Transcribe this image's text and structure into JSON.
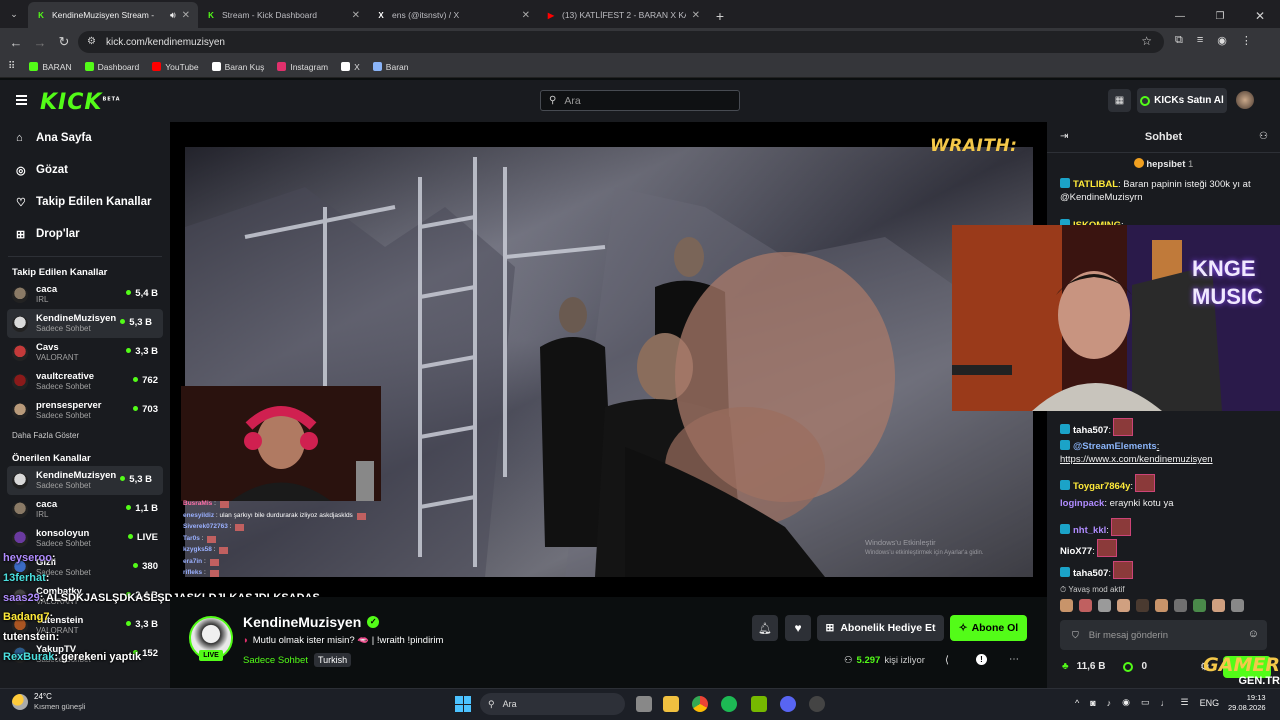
{
  "browser": {
    "tabs": [
      {
        "label": "KendineMuzisyen Stream -",
        "active": true,
        "fav": "K",
        "fav_color": "#53fc18"
      },
      {
        "label": "Stream - Kick Dashboard",
        "active": false,
        "fav": "K",
        "fav_color": "#53fc18"
      },
      {
        "label": "ens (@itsnstv) / X",
        "active": false,
        "fav": "X",
        "fav_color": "#ffffff"
      },
      {
        "label": "(13) KATLİFEST 2 - BARAN X KA",
        "active": false,
        "fav": "▶",
        "fav_color": "#ff0000"
      }
    ],
    "url": "kick.com/kendinemuzisyen",
    "bookmarks": [
      {
        "label": "BARAN",
        "icon": "kick-icon",
        "color": "#53fc18"
      },
      {
        "label": "Dashboard",
        "icon": "kick-icon",
        "color": "#53fc18"
      },
      {
        "label": "YouTube",
        "icon": "youtube-icon",
        "color": "#ff0000"
      },
      {
        "label": "Baran Kuş",
        "icon": "tiktok-icon",
        "color": "#ffffff"
      },
      {
        "label": "Instagram",
        "icon": "instagram-icon",
        "color": "#e1306c"
      },
      {
        "label": "X",
        "icon": "x-icon",
        "color": "#ffffff"
      },
      {
        "label": "Baran",
        "icon": "globe-icon",
        "color": "#8ab4f8"
      }
    ]
  },
  "header": {
    "logo": "KICK",
    "logo_sup": "BETA",
    "search_placeholder": "Ara",
    "buy_kicks": "KICKs Satın Al"
  },
  "sidebar": {
    "nav": [
      {
        "label": "Ana Sayfa",
        "icon": "home-icon"
      },
      {
        "label": "Gözat",
        "icon": "compass-icon"
      },
      {
        "label": "Takip Edilen Kanallar",
        "icon": "heart-icon"
      },
      {
        "label": "Drop'lar",
        "icon": "gift-icon"
      }
    ],
    "followed_title": "Takip Edilen Kanallar",
    "followed": [
      {
        "name": "caca",
        "sub": "IRL",
        "viewers": "5,4 B",
        "color": "#8a7a66"
      },
      {
        "name": "KendineMuzisyen",
        "sub": "Sadece Sohbet",
        "viewers": "5,3 B",
        "color": "#d9d9d9"
      },
      {
        "name": "Cavs",
        "sub": "VALORANT",
        "viewers": "3,3 B",
        "color": "#c43a3a"
      },
      {
        "name": "vaultcreative",
        "sub": "Sadece Sohbet",
        "viewers": "762",
        "color": "#8b1a1a"
      },
      {
        "name": "prensesperver",
        "sub": "Sadece Sohbet",
        "viewers": "703",
        "color": "#b89a7a"
      }
    ],
    "show_more": "Daha Fazla Göster",
    "recommended_title": "Önerilen Kanallar",
    "recommended": [
      {
        "name": "KendineMuzisyen",
        "sub": "Sadece Sohbet",
        "viewers": "5,3 B",
        "color": "#d9d9d9"
      },
      {
        "name": "caca",
        "sub": "IRL",
        "viewers": "1,1 B",
        "color": "#8a7a66"
      },
      {
        "name": "konsoloyun",
        "sub": "Sadece Sohbet",
        "viewers": "LIVE",
        "color": "#6a3aa0"
      },
      {
        "name": "Gizli",
        "sub": "Sadece Sohbet",
        "viewers": "380",
        "color": "#3a6ac4"
      },
      {
        "name": "Combatky",
        "sub": "VALORANT",
        "viewers": "2,4 B",
        "color": "#444"
      },
      {
        "name": "Tutenstein",
        "sub": "VALORANT",
        "viewers": "3,3 B",
        "color": "#aa5522"
      },
      {
        "name": "YakupTV",
        "sub": "Sadece Sohbet",
        "viewers": "152",
        "color": "#2a5a8a"
      }
    ]
  },
  "player": {
    "overlay_brand": "WRAITH:",
    "windows_activate_title": "Windows'u Etkinleştir",
    "windows_activate_sub": "Windows'u etkinleştirmek için Ayarlar'a gidin.",
    "mini_chat": [
      {
        "user": "BusraMis",
        "msg": ":",
        "color": "#ff6fa8"
      },
      {
        "user": "enesyildiz",
        "msg": ": ulan şarkıyı bile durdurarak izliyoz askdjasklds",
        "color": "#ffffff"
      },
      {
        "user": "Siverek072763",
        "msg": ":",
        "color": "#ffffff"
      },
      {
        "user": "Tar0s",
        "msg": ":",
        "color": "#ffffff"
      },
      {
        "user": "kzygks58",
        "msg": ":",
        "color": "#ffffff"
      },
      {
        "user": "era7in",
        "msg": ":",
        "color": "#ffffff"
      },
      {
        "user": "rifleks",
        "msg": ":",
        "color": "#ffffff"
      }
    ]
  },
  "overlay_chat": [
    {
      "user": "heyseroo",
      "msg": ":",
      "color": "#b08cff"
    },
    {
      "user": "13ferhat",
      "msg": ":",
      "color": "#4ce0e0"
    },
    {
      "user": "saas29",
      "msg": ": ALSDKJASLŞDKASLŞDJASKLDJLKASJDLKSADAS",
      "color": "#b08cff"
    },
    {
      "user": "Badang7",
      "msg": ":",
      "color": "#ffea3a"
    },
    {
      "user": "tutenstein",
      "msg": ":",
      "color": "#ffffff"
    },
    {
      "user": "RexBurak",
      "msg": ": gerekeni yaptık",
      "color": "#4ce0e0"
    }
  ],
  "stream": {
    "name": "KendineMuzisyen",
    "title": "Mutlu olmak ister misin? 🫦 | !wraith !pindirim",
    "category": "Sadece Sohbet",
    "tag": "Turkish",
    "live": "LIVE",
    "viewers": "5.297",
    "viewers_label": "kişi izliyor",
    "gift_sub": "Abonelik Hediye Et",
    "subscribe": "Abone Ol"
  },
  "chat": {
    "title": "Sohbet",
    "pinned_user": "hepsibet",
    "pinned_count": "1",
    "messages_top": [
      {
        "user": "TATLIBAL",
        "msg": ": Baran papinin isteği 300k yı at @KendineMuzisyrn",
        "color": "#ffea3a"
      },
      {
        "user": "ISKOMING",
        "msg": ":",
        "color": "#ffea3a"
      }
    ],
    "messages": [
      {
        "user": "taha507",
        "msg": ":",
        "color": "#ffffff"
      },
      {
        "user": "@StreamElements",
        "msg": ": https://www.x.com/kendinemuzisyen",
        "color": "#8ab4f8"
      },
      {
        "user": "Toygar7864y",
        "msg": ":",
        "color": "#ffea3a"
      },
      {
        "user": "loginpack",
        "msg": ": eraynki kotu ya",
        "color": "#b08cff"
      },
      {
        "user": "nht_kkl",
        "msg": ":",
        "color": "#b08cff"
      },
      {
        "user": "NioX77",
        "msg": ":",
        "color": "#ffffff"
      },
      {
        "user": "taha507",
        "msg": ":",
        "color": "#ffffff"
      }
    ],
    "slow_mode": "Yavaş mod aktif",
    "input_placeholder": "Bir mesaj gönderin",
    "balance": "11,6 B",
    "coins": "0",
    "watermark": "GAMER",
    "watermark_sub": "GEN.TR"
  },
  "webcam_brand": "KNGE MUSIC",
  "taskbar": {
    "weather_temp": "24°C",
    "weather_desc": "Kısmen güneşli",
    "search": "Ara",
    "time": "19:13",
    "date": "29.08.2026",
    "lang": "ENG"
  }
}
